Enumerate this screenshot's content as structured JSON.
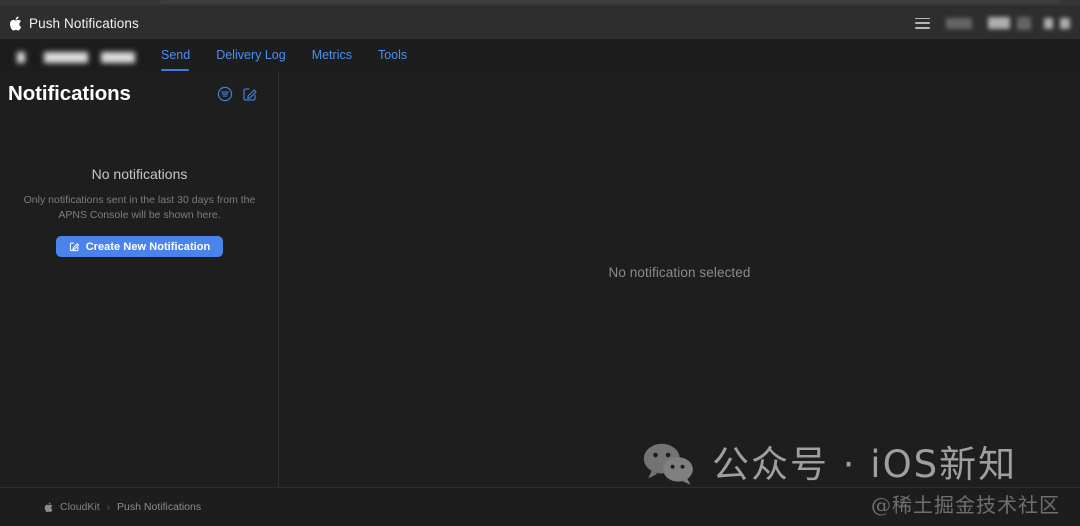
{
  "window": {
    "title": "Push Notifications",
    "apple_logo_icon": "apple-logo-icon"
  },
  "topbar": {
    "menu_icon": "hamburger-menu-icon",
    "account_redacted": true
  },
  "nav": {
    "app_selector_redacted": true,
    "tabs": [
      {
        "label": "Send",
        "active": true
      },
      {
        "label": "Delivery Log",
        "active": false
      },
      {
        "label": "Metrics",
        "active": false
      },
      {
        "label": "Tools",
        "active": false
      }
    ]
  },
  "sidebar": {
    "title": "Notifications",
    "actions": [
      {
        "name": "filter-icon",
        "label": "Filter"
      },
      {
        "name": "compose-icon",
        "label": "Compose"
      }
    ],
    "empty_state": {
      "title": "No notifications",
      "description": "Only notifications sent in the last 30 days from the APNS Console will be shown here.",
      "button_label": "Create New Notification",
      "button_icon": "compose-icon"
    }
  },
  "main": {
    "empty_message": "No notification selected"
  },
  "footer": {
    "breadcrumb": [
      {
        "label": "CloudKit",
        "icon": "apple-logo-icon",
        "current": false
      },
      {
        "label": "Push Notifications",
        "icon": null,
        "current": true
      }
    ],
    "separator": "›"
  },
  "watermark": {
    "logo_icon": "wechat-logo-icon",
    "text": "公众号 · iOS新知",
    "subtext": "@稀土掘金技术社区"
  },
  "colors": {
    "accent_blue": "#4c8ff0",
    "button_blue": "#4b83ec",
    "topbar_bg": "#2e2e2e",
    "page_bg": "#1d1d1d",
    "pane_bg": "#1e1e1e",
    "divider": "#313131"
  }
}
